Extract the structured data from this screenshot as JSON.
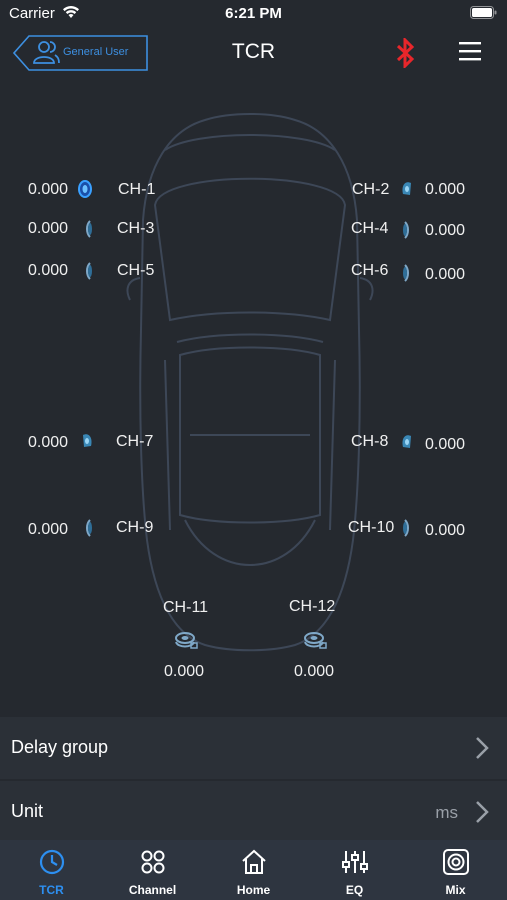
{
  "status_bar": {
    "carrier": "Carrier",
    "time": "6:21 PM"
  },
  "header": {
    "user_button_label": "General User",
    "title": "TCR"
  },
  "channels": [
    {
      "label": "CH-1",
      "value": "0.000"
    },
    {
      "label": "CH-2",
      "value": "0.000"
    },
    {
      "label": "CH-3",
      "value": "0.000"
    },
    {
      "label": "CH-4",
      "value": "0.000"
    },
    {
      "label": "CH-5",
      "value": "0.000"
    },
    {
      "label": "CH-6",
      "value": "0.000"
    },
    {
      "label": "CH-7",
      "value": "0.000"
    },
    {
      "label": "CH-8",
      "value": "0.000"
    },
    {
      "label": "CH-9",
      "value": "0.000"
    },
    {
      "label": "CH-10",
      "value": "0.000"
    },
    {
      "label": "CH-11",
      "value": "0.000"
    },
    {
      "label": "CH-12",
      "value": "0.000"
    }
  ],
  "settings": {
    "delay_group": {
      "label": "Delay group"
    },
    "unit": {
      "label": "Unit",
      "value": "ms"
    }
  },
  "tabs": [
    {
      "label": "TCR",
      "icon": "clock-icon",
      "active": true
    },
    {
      "label": "Channel",
      "icon": "grid-icon",
      "active": false
    },
    {
      "label": "Home",
      "icon": "home-icon",
      "active": false
    },
    {
      "label": "EQ",
      "icon": "sliders-icon",
      "active": false
    },
    {
      "label": "Mix",
      "icon": "speaker-icon",
      "active": false
    }
  ],
  "colors": {
    "background": "#25292f",
    "accent": "#2d8ff0",
    "bluetooth": "#e8262b",
    "tabbar": "#2e3540"
  }
}
